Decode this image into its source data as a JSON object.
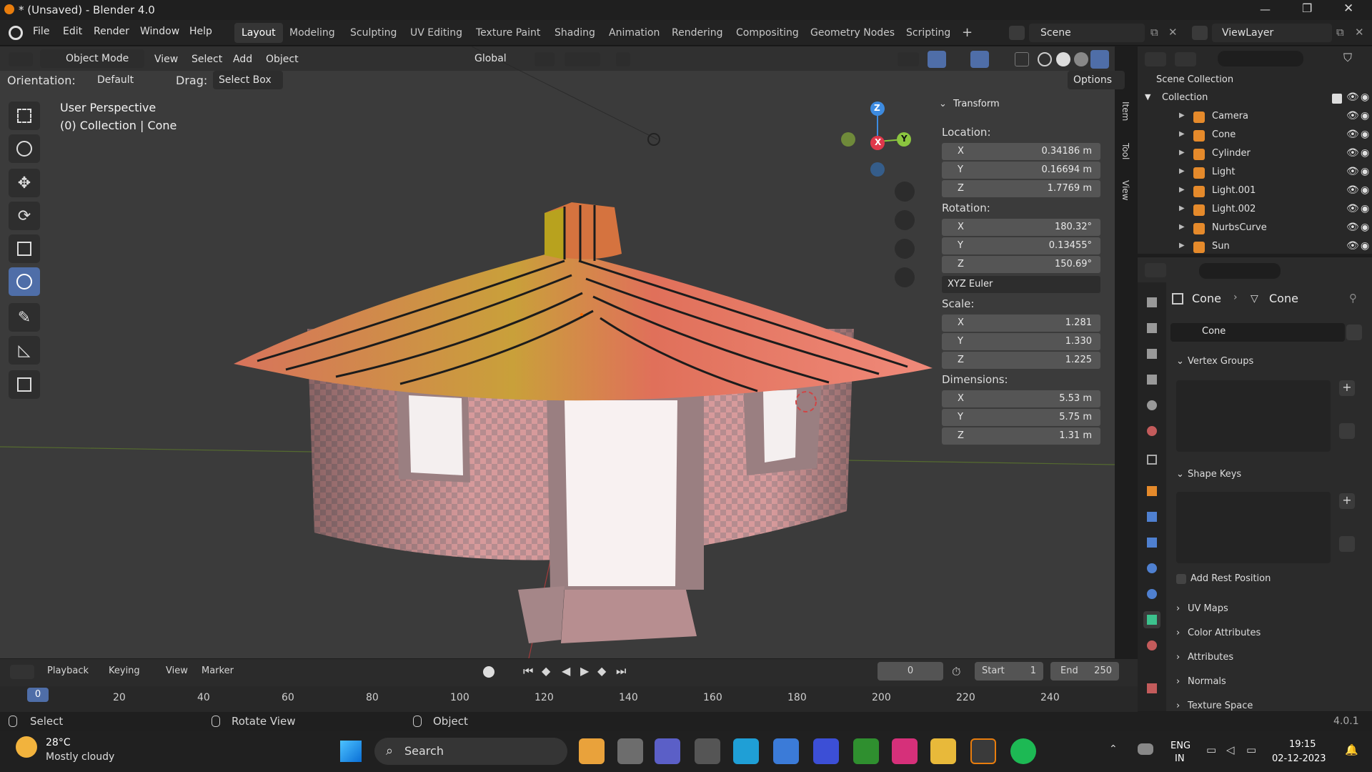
{
  "window": {
    "title": "* (Unsaved) - Blender 4.0"
  },
  "menu": {
    "items": [
      "File",
      "Edit",
      "Render",
      "Window",
      "Help"
    ]
  },
  "workspaces": {
    "tabs": [
      "Layout",
      "Modeling",
      "Sculpting",
      "UV Editing",
      "Texture Paint",
      "Shading",
      "Animation",
      "Rendering",
      "Compositing",
      "Geometry Nodes",
      "Scripting"
    ],
    "active": "Layout",
    "add": "+"
  },
  "scene": {
    "name": "Scene",
    "view_layer": "ViewLayer"
  },
  "viewport_header": {
    "mode": "Object Mode",
    "menus": [
      "View",
      "Select",
      "Add",
      "Object"
    ],
    "transform": "Global",
    "orientation_label": "Orientation:",
    "orientation": "Default",
    "drag_label": "Drag:",
    "drag": "Select Box",
    "options": "Options"
  },
  "viewport_info": {
    "perspective": "User Perspective",
    "collection": "(0) Collection | Cone"
  },
  "gizmo": {
    "x": "X",
    "y": "Y",
    "z": "Z"
  },
  "npanel": {
    "title": "Transform",
    "location_label": "Location:",
    "location": [
      {
        "axis": "X",
        "value": "0.34186 m"
      },
      {
        "axis": "Y",
        "value": "0.16694 m"
      },
      {
        "axis": "Z",
        "value": "1.7769 m"
      }
    ],
    "rotation_label": "Rotation:",
    "rotation": [
      {
        "axis": "X",
        "value": "180.32°"
      },
      {
        "axis": "Y",
        "value": "0.13455°"
      },
      {
        "axis": "Z",
        "value": "150.69°"
      }
    ],
    "rotation_mode": "XYZ Euler",
    "scale_label": "Scale:",
    "scale": [
      {
        "axis": "X",
        "value": "1.281"
      },
      {
        "axis": "Y",
        "value": "1.330"
      },
      {
        "axis": "Z",
        "value": "1.225"
      }
    ],
    "dimensions_label": "Dimensions:",
    "dimensions": [
      {
        "axis": "X",
        "value": "5.53 m"
      },
      {
        "axis": "Y",
        "value": "5.75 m"
      },
      {
        "axis": "Z",
        "value": "1.31 m"
      }
    ],
    "tabs": [
      "Item",
      "Tool",
      "View"
    ]
  },
  "outliner": {
    "scene_collection": "Scene Collection",
    "collection": "Collection",
    "objects": [
      "Camera",
      "Cone",
      "Cylinder",
      "Light",
      "Light.001",
      "Light.002",
      "NurbsCurve",
      "Sun"
    ]
  },
  "properties": {
    "breadcrumb_object": "Cone",
    "breadcrumb_data": "Cone",
    "data_name": "Cone",
    "sections": {
      "vertex_groups": "Vertex Groups",
      "shape_keys": "Shape Keys",
      "add_rest": "Add Rest Position",
      "uv_maps": "UV Maps",
      "color_attributes": "Color Attributes",
      "attributes": "Attributes",
      "normals": "Normals",
      "texture_space": "Texture Space"
    }
  },
  "timeline": {
    "menus": [
      "Playback",
      "Keying",
      "View",
      "Marker"
    ],
    "current_frame": "0",
    "start_label": "Start",
    "start": "1",
    "end_label": "End",
    "end": "250",
    "ticks": [
      "0",
      "20",
      "40",
      "60",
      "80",
      "100",
      "120",
      "140",
      "160",
      "180",
      "200",
      "220",
      "240"
    ]
  },
  "status": {
    "select": "Select",
    "rotate": "Rotate View",
    "object": "Object",
    "version": "4.0.1"
  },
  "taskbar": {
    "temp": "28°C",
    "weather": "Mostly cloudy",
    "search": "Search",
    "lang1": "ENG",
    "lang2": "IN",
    "time": "19:15",
    "date": "02-12-2023"
  },
  "colors": {
    "accent": "#4f6ea8",
    "x_axis": "#e0384b",
    "y_axis": "#8bc53f",
    "z_axis": "#3d8be0"
  }
}
